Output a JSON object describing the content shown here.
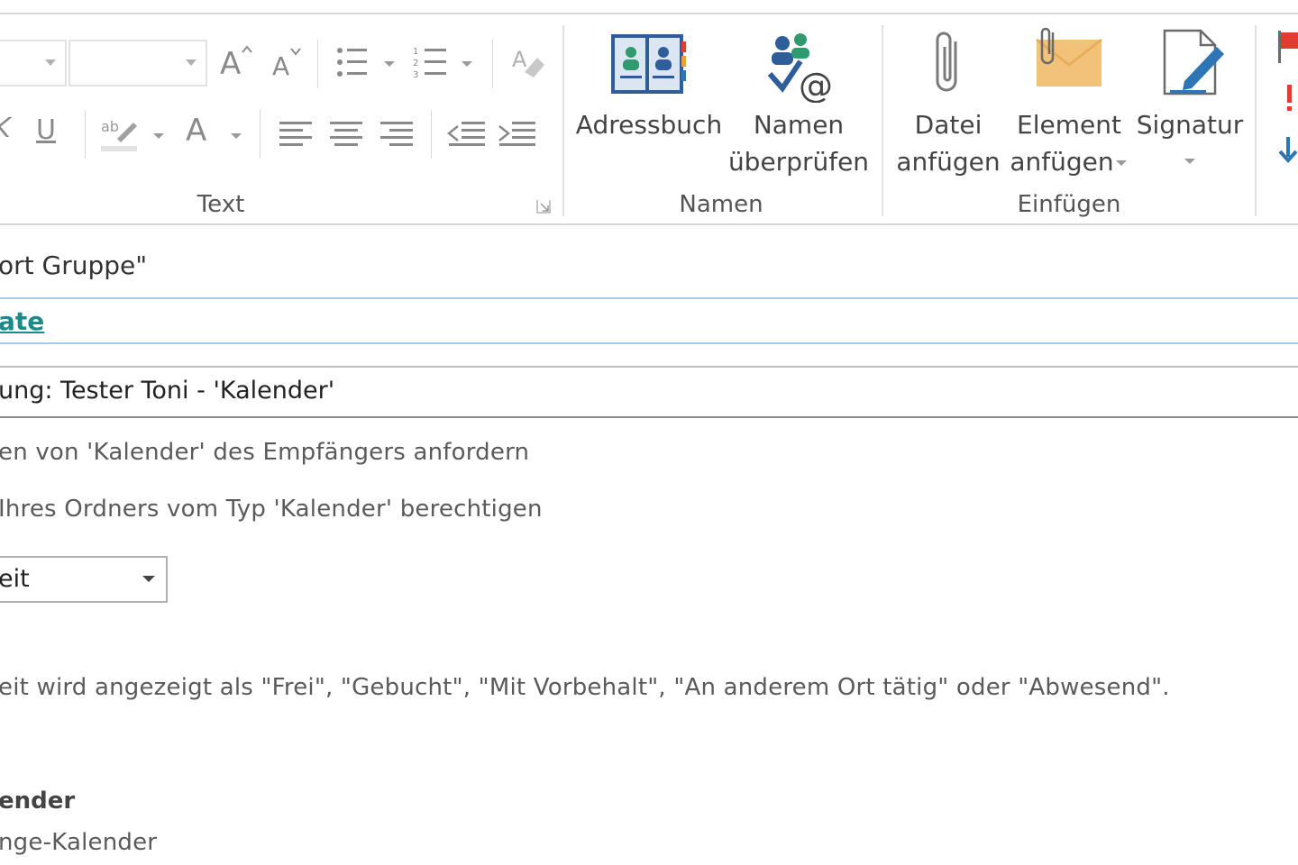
{
  "ribbon": {
    "groups": {
      "text": "Text",
      "names": "Namen",
      "insert": "Einfügen"
    },
    "buttons": {
      "address_book": "Adressbuch",
      "check_names_line1": "Namen",
      "check_names_line2": "überprüfen",
      "attach_file_line1": "Datei",
      "attach_file_line2": "anfügen",
      "attach_item_line1": "Element",
      "attach_item_line2": "anfügen",
      "signature": "Signatur"
    },
    "glyphs": {
      "grow_font": "A",
      "shrink_font": "A",
      "underline": "U",
      "italic_partial": "K",
      "font_color": "A"
    }
  },
  "message": {
    "to_partial": "ort Gruppe\"",
    "cc_partial": "ate",
    "subject_partial": "ung: Tester Toni - 'Kalender'",
    "body_line1": "en von 'Kalender' des Empfängers anfordern",
    "body_line2": "Ihres Ordners vom Typ 'Kalender' berechtigen",
    "permission_selected": "eit",
    "availability_note": "eit wird angezeigt als \"Frei\", \"Gebucht\", \"Mit Vorbehalt\", \"An anderem Ort tätig\" oder \"Abwesend\".",
    "calendar_heading": "ender",
    "calendar_sub": "nge-Kalender"
  },
  "colors": {
    "accent_blue": "#2e75b6",
    "link_teal": "#1a8a8a",
    "flag_red": "#e03c31",
    "focus_border": "#a9c8e8"
  }
}
